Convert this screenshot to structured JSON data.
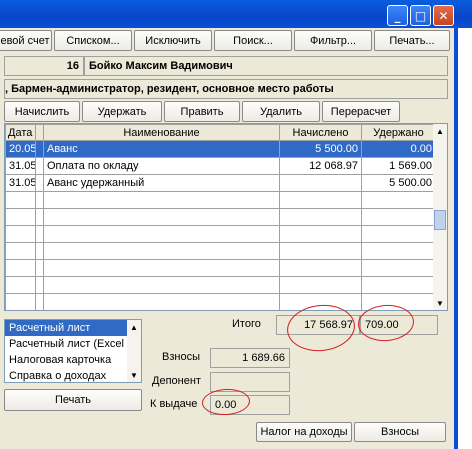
{
  "toolbar": {
    "items": [
      "евой счет",
      "Списком...",
      "Исключить",
      "Поиск...",
      "Фильтр...",
      "Печать..."
    ]
  },
  "employee": {
    "number": "16",
    "name": "Бойко Максим Вадимович",
    "position": ", Бармен-администратор, резидент, основное место работы"
  },
  "actions": [
    "Начислить",
    "Удержать",
    "Править",
    "Удалить",
    "Перерасчет"
  ],
  "table": {
    "headers": [
      "Дата",
      "Наименование",
      "Начислено",
      "Удержано"
    ],
    "rows": [
      {
        "date": "20.05",
        "name": "Аванс",
        "charged": "5 500.00",
        "withheld": "0.00"
      },
      {
        "date": "31.05",
        "name": "Оплата по окладу",
        "charged": "12 068.97",
        "withheld": "1 569.00"
      },
      {
        "date": "31.05",
        "name": "Аванс удержанный",
        "charged": "",
        "withheld": "5 500.00"
      }
    ]
  },
  "reports": {
    "items": [
      "Расчетный лист",
      "Расчетный лист (Excel",
      "Налоговая карточка",
      "Справка о доходах"
    ]
  },
  "totals": {
    "itogo_label": "Итого",
    "charged_total": "17 568.97",
    "withheld_total": "709.00",
    "vznosy_label": "Взносы",
    "vznosy_value": "1 689.66",
    "deponent_label": "Депонент",
    "deponent_value": "",
    "kvydache_label": "К выдаче",
    "kvydache_value": "0.00"
  },
  "bottom": {
    "print": "Печать",
    "tax": "Налог на доходы",
    "contrib": "Взносы"
  },
  "window": {
    "minimize_glyph": "_",
    "maximize_glyph": "□",
    "close_glyph": "✕"
  }
}
